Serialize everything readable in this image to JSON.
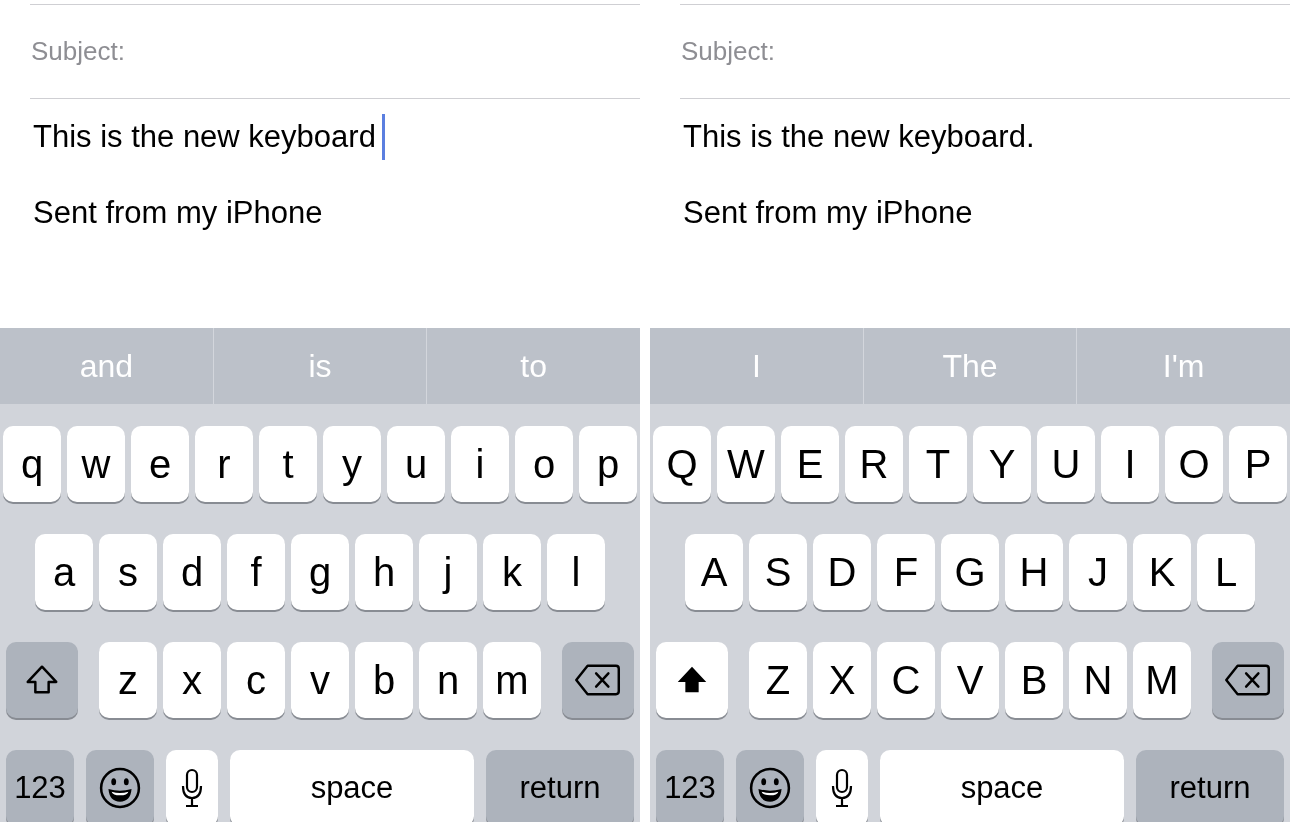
{
  "screens": [
    {
      "subject_label": "Subject:",
      "body": "This is the new keyboard",
      "cursor": true,
      "signature": "Sent from my iPhone",
      "suggestions": [
        "and",
        "is",
        "to"
      ],
      "shift_on": false,
      "rows": [
        [
          "q",
          "w",
          "e",
          "r",
          "t",
          "y",
          "u",
          "i",
          "o",
          "p"
        ],
        [
          "a",
          "s",
          "d",
          "f",
          "g",
          "h",
          "j",
          "k",
          "l"
        ],
        [
          "z",
          "x",
          "c",
          "v",
          "b",
          "n",
          "m"
        ]
      ],
      "numbers_key": "123",
      "space_key": "space",
      "return_key": "return"
    },
    {
      "subject_label": "Subject:",
      "body": "This is the new keyboard.",
      "cursor": false,
      "signature": "Sent from my iPhone",
      "suggestions": [
        "I",
        "The",
        "I'm"
      ],
      "shift_on": true,
      "rows": [
        [
          "Q",
          "W",
          "E",
          "R",
          "T",
          "Y",
          "U",
          "I",
          "O",
          "P"
        ],
        [
          "A",
          "S",
          "D",
          "F",
          "G",
          "H",
          "J",
          "K",
          "L"
        ],
        [
          "Z",
          "X",
          "C",
          "V",
          "B",
          "N",
          "M"
        ]
      ],
      "numbers_key": "123",
      "space_key": "space",
      "return_key": "return"
    }
  ]
}
